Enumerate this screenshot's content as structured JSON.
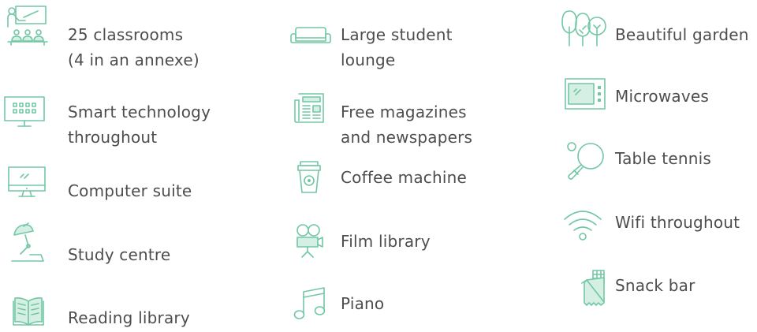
{
  "colors": {
    "icon": "#72c7a5",
    "icon_fill": "#d6efe4",
    "text": "#4d4d4d"
  },
  "facilities": [
    {
      "icon": "classroom-icon",
      "lines": [
        "25 classrooms",
        "(4 in an annexe)"
      ]
    },
    {
      "icon": "smartboard-icon",
      "lines": [
        "Smart technology",
        "throughout"
      ]
    },
    {
      "icon": "computer-icon",
      "lines": [
        "Computer suite"
      ]
    },
    {
      "icon": "desk-lamp-icon",
      "lines": [
        "Study centre"
      ]
    },
    {
      "icon": "book-icon",
      "lines": [
        "Reading library"
      ]
    },
    {
      "icon": "sofa-icon",
      "lines": [
        "Large student",
        "lounge"
      ]
    },
    {
      "icon": "newspaper-icon",
      "lines": [
        "Free magazines",
        "and newspapers"
      ]
    },
    {
      "icon": "coffee-cup-icon",
      "lines": [
        "Coffee machine"
      ]
    },
    {
      "icon": "film-camera-icon",
      "lines": [
        "Film library"
      ]
    },
    {
      "icon": "music-note-icon",
      "lines": [
        "Piano"
      ]
    },
    {
      "icon": "trees-icon",
      "lines": [
        "Beautiful garden"
      ]
    },
    {
      "icon": "microwave-icon",
      "lines": [
        "Microwaves"
      ]
    },
    {
      "icon": "table-tennis-icon",
      "lines": [
        "Table tennis"
      ]
    },
    {
      "icon": "wifi-icon",
      "lines": [
        "Wifi throughout"
      ]
    },
    {
      "icon": "chocolate-bar-icon",
      "lines": [
        "Snack bar"
      ]
    }
  ]
}
